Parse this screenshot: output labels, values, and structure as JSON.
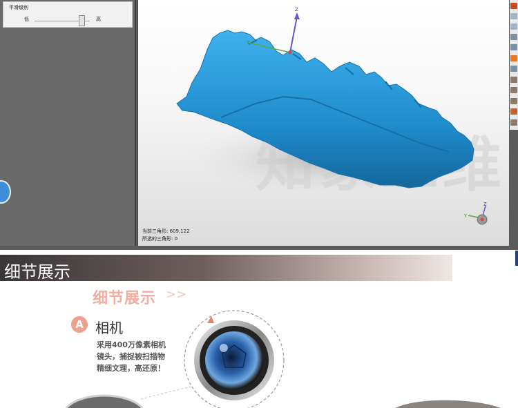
{
  "smooth_panel": {
    "title": "平滑级别",
    "low_label": "低",
    "high_label": "高",
    "slider_level": 0.85
  },
  "viewport": {
    "axes_main": {
      "z": "Z",
      "y": "Y"
    },
    "axes_small": {
      "z": "Z",
      "y": "Y"
    },
    "watermark": "知象三维",
    "current_triangles": "当前三角形: 609,122",
    "selected_triangles": "所选的三角形: 0",
    "model_color": "#2a9ad8"
  },
  "toolbar": {
    "icons": [
      "render-icon",
      "view-icon",
      "view-icon",
      "tool-icon",
      "tool-icon",
      "select-icon",
      "tool-icon",
      "tool-icon",
      "tool-icon",
      "tool-icon",
      "tool-icon",
      "tool-icon"
    ]
  },
  "section": {
    "title": "细节展示"
  },
  "detail": {
    "logo_text": "细节展示",
    "arrows": ">>",
    "badge": "A",
    "camera_title": "相机",
    "camera_desc": [
      "采用400万像素相机",
      "镜头，捕捉被扫描物",
      "精细文理，高还原！"
    ]
  }
}
